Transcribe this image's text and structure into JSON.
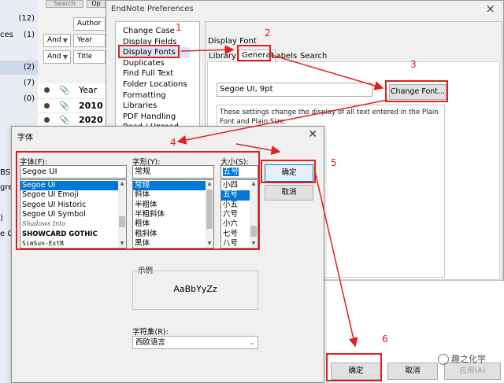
{
  "main_window": {
    "search_button": "Search",
    "options_button": "Op",
    "groups": [
      {
        "name": "",
        "count": "(12)"
      },
      {
        "name": "ces",
        "count": "(1)"
      },
      {
        "name": "",
        "count": "(2)"
      },
      {
        "name": "",
        "count": "(7)"
      },
      {
        "name": "",
        "count": "(0)"
      }
    ],
    "search_rows": [
      {
        "bool": "",
        "field": "Author"
      },
      {
        "bool": "And",
        "field": "Year"
      },
      {
        "bool": "And",
        "field": "Title"
      }
    ],
    "ref_header_year": "Year",
    "refs": [
      "2010",
      "2020"
    ],
    "left_fragments": [
      "BS.",
      "gre",
      ")",
      "e C"
    ]
  },
  "preferences": {
    "title": "EndNote Preferences",
    "categories": [
      "Change Case",
      "Display Fields",
      "Display Fonts",
      "Duplicates",
      "Find Full Text",
      "Folder Locations",
      "Formatting",
      "Libraries",
      "PDF Handling",
      "Read / Unread"
    ],
    "selected_category": "Display Fonts",
    "panel_title": "Display Font",
    "tabs": [
      "Library",
      "General",
      "Labels",
      "Search"
    ],
    "active_tab": "General",
    "current_font": "Segoe UI, 9pt",
    "change_font_button": "Change Font...",
    "description": "These settings change the display of all text entered in the Plain Font and Plain Size."
  },
  "font_dialog": {
    "title": "字体",
    "font_label": "字体(F):",
    "font_value": "Segoe UI",
    "fonts": [
      "Segoe UI",
      "Segoe UI Emoji",
      "Segoe UI Historic",
      "Segoe UI Symbol",
      "Shadows Into",
      "SHOWCARD GOTHIC",
      "SimSun-ExtB"
    ],
    "style_label": "字形(Y):",
    "style_value": "常规",
    "styles": [
      "常规",
      "斜体",
      "半粗体",
      "半粗斜体",
      "粗体",
      "粗斜体",
      "黑体"
    ],
    "size_label": "大小(S):",
    "size_value": "五号",
    "sizes": [
      "小四",
      "五号",
      "小五",
      "六号",
      "小六",
      "七号",
      "八号"
    ],
    "ok_button": "确定",
    "cancel_button": "取消",
    "sample_label": "示例",
    "sample_text": "AaBbYyZz",
    "script_label": "字符集(R):",
    "script_value": "西欧语言"
  },
  "pref_buttons": {
    "ok": "确定",
    "cancel": "取消",
    "apply": "应用(A)"
  },
  "annotations": [
    "1",
    "2",
    "3",
    "4",
    "5",
    "6"
  ],
  "watermark": "趣之化学",
  "colors": {
    "annotation": "#e0201f",
    "selection": "#0078d7"
  }
}
